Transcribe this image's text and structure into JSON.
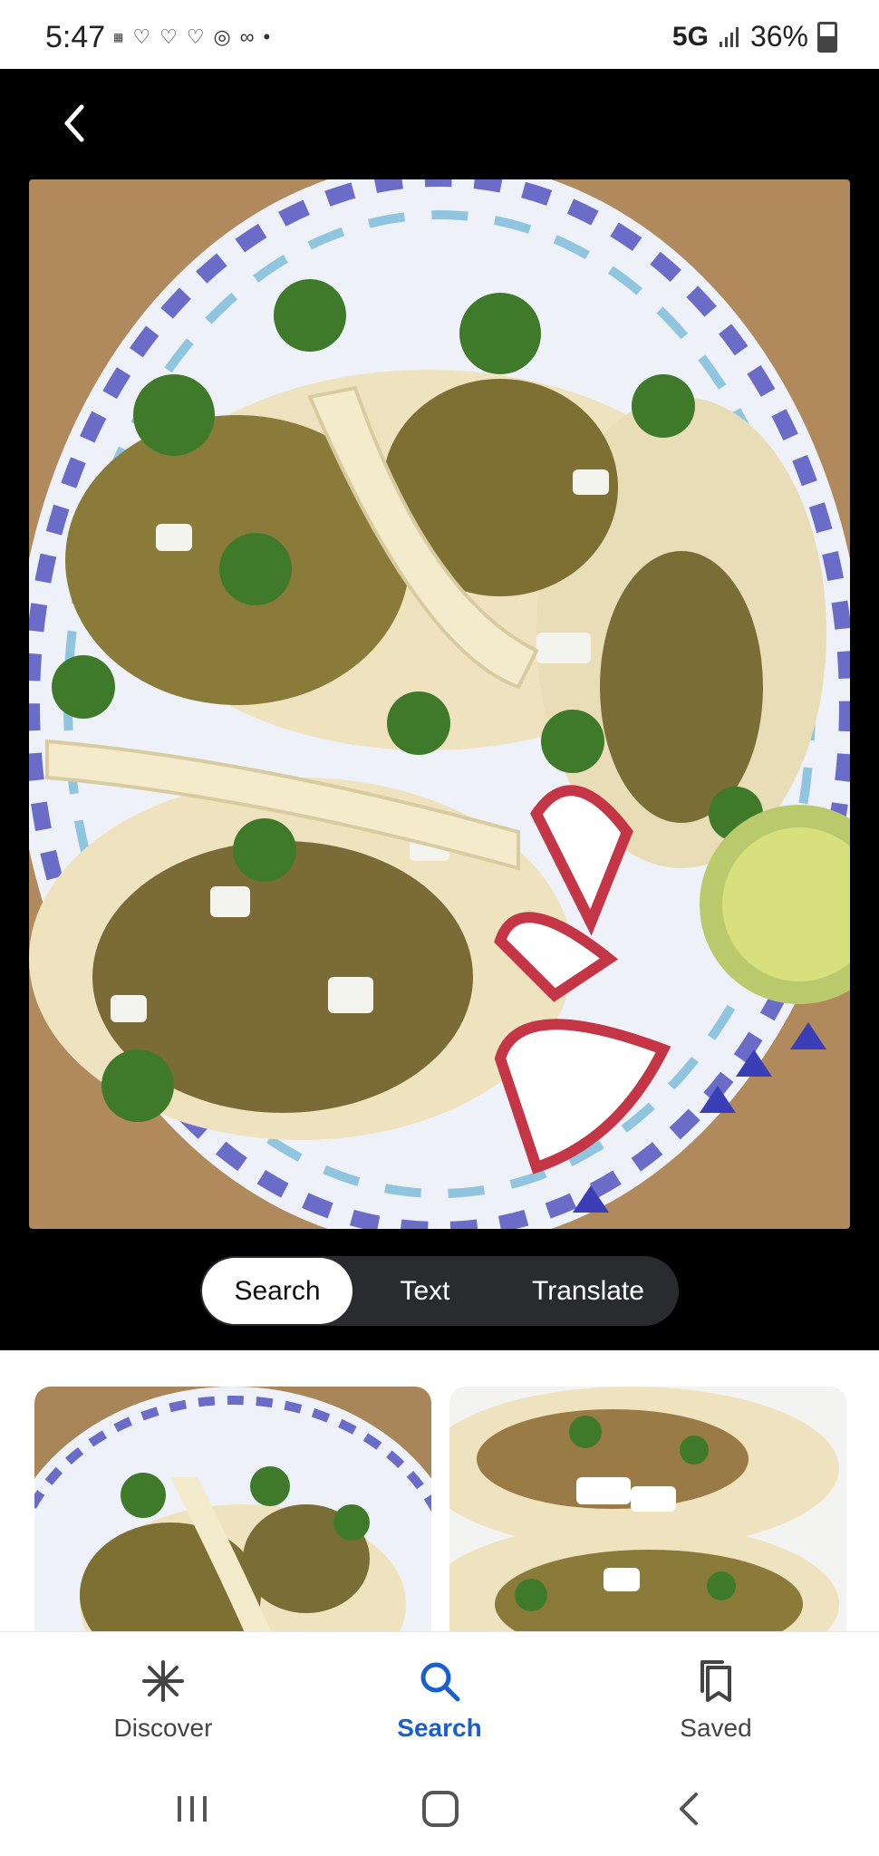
{
  "status": {
    "time": "5:47",
    "network": "5G",
    "battery": "36%"
  },
  "lens": {
    "tabs": [
      {
        "label": "Search",
        "active": true
      },
      {
        "label": "Text",
        "active": false
      },
      {
        "label": "Translate",
        "active": false
      }
    ]
  },
  "nav": {
    "items": [
      {
        "label": "Discover",
        "icon": "asterisk-icon"
      },
      {
        "label": "Search",
        "icon": "search-icon",
        "active": true
      },
      {
        "label": "Saved",
        "icon": "bookmarks-icon"
      }
    ]
  },
  "colors": {
    "accent": "#1a5fd0",
    "background": "#000000",
    "tab_bar": "#2a2b2f"
  }
}
